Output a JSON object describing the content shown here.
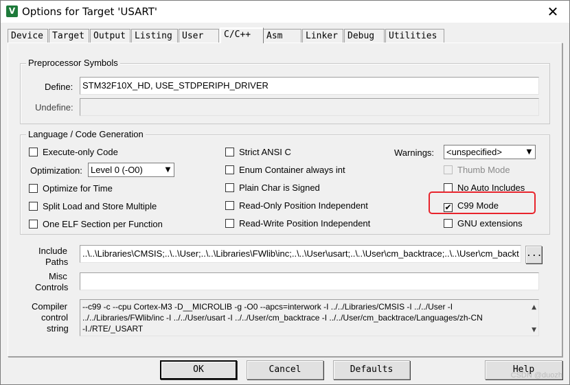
{
  "window": {
    "title": "Options for Target 'USART'",
    "icon": "keil-uvision-icon",
    "close": "✕"
  },
  "tabs": [
    {
      "label": "Device"
    },
    {
      "label": "Target"
    },
    {
      "label": "Output"
    },
    {
      "label": "Listing"
    },
    {
      "label": "User"
    },
    {
      "label": "C/C++",
      "active": true
    },
    {
      "label": "Asm"
    },
    {
      "label": "Linker"
    },
    {
      "label": "Debug"
    },
    {
      "label": "Utilities"
    }
  ],
  "preprocessor": {
    "title": "Preprocessor Symbols",
    "define_label": "Define:",
    "define_value": "STM32F10X_HD, USE_STDPERIPH_DRIVER",
    "undefine_label": "Undefine:",
    "undefine_value": ""
  },
  "language": {
    "title": "Language / Code Generation",
    "execute_only": {
      "label": "Execute-only Code",
      "checked": false
    },
    "optimization_label": "Optimization:",
    "optimization_value": "Level 0 (-O0)",
    "optimize_time": {
      "label": "Optimize for Time",
      "checked": false
    },
    "split_load": {
      "label": "Split Load and Store Multiple",
      "checked": false
    },
    "one_elf": {
      "label": "One ELF Section per Function",
      "checked": false
    },
    "strict_ansi": {
      "label": "Strict ANSI C",
      "checked": false
    },
    "enum_container": {
      "label": "Enum Container always int",
      "checked": false
    },
    "plain_char": {
      "label": "Plain Char is Signed",
      "checked": false
    },
    "ro_pi": {
      "label": "Read-Only Position Independent",
      "checked": false
    },
    "rw_pi": {
      "label": "Read-Write Position Independent",
      "checked": false
    },
    "warnings_label": "Warnings:",
    "warnings_value": "<unspecified>",
    "thumb_mode": {
      "label": "Thumb Mode",
      "checked": false,
      "disabled": true
    },
    "no_auto_includes": {
      "label": "No Auto Includes",
      "checked": false
    },
    "c99_mode": {
      "label": "C99 Mode",
      "checked": true,
      "mark": "✔"
    },
    "gnu_extensions": {
      "label": "GNU extensions",
      "checked": false
    }
  },
  "include_paths": {
    "label_line1": "Include",
    "label_line2": "Paths",
    "value": "..\\..\\Libraries\\CMSIS;..\\..\\User;..\\..\\Libraries\\FWlib\\inc;..\\..\\User\\usart;..\\..\\User\\cm_backtrace;..\\..\\User\\cm_backt",
    "browse_label": "..."
  },
  "misc_controls": {
    "label_line1": "Misc",
    "label_line2": "Controls",
    "value": ""
  },
  "compiler_string": {
    "label_line1": "Compiler",
    "label_line2": "control",
    "label_line3": "string",
    "line1": "--c99 -c --cpu Cortex-M3 -D__MICROLIB -g -O0 --apcs=interwork -I ../../Libraries/CMSIS -I ../../User -I",
    "line2": "../../Libraries/FWlib/inc -I ../../User/usart -I ../../User/cm_backtrace -I ../../User/cm_backtrace/Languages/zh-CN",
    "line3": "-I./RTE/_USART"
  },
  "buttons": {
    "ok": "OK",
    "cancel": "Cancel",
    "defaults": "Defaults",
    "help": "Help"
  },
  "watermark": "CSDN @duozh"
}
